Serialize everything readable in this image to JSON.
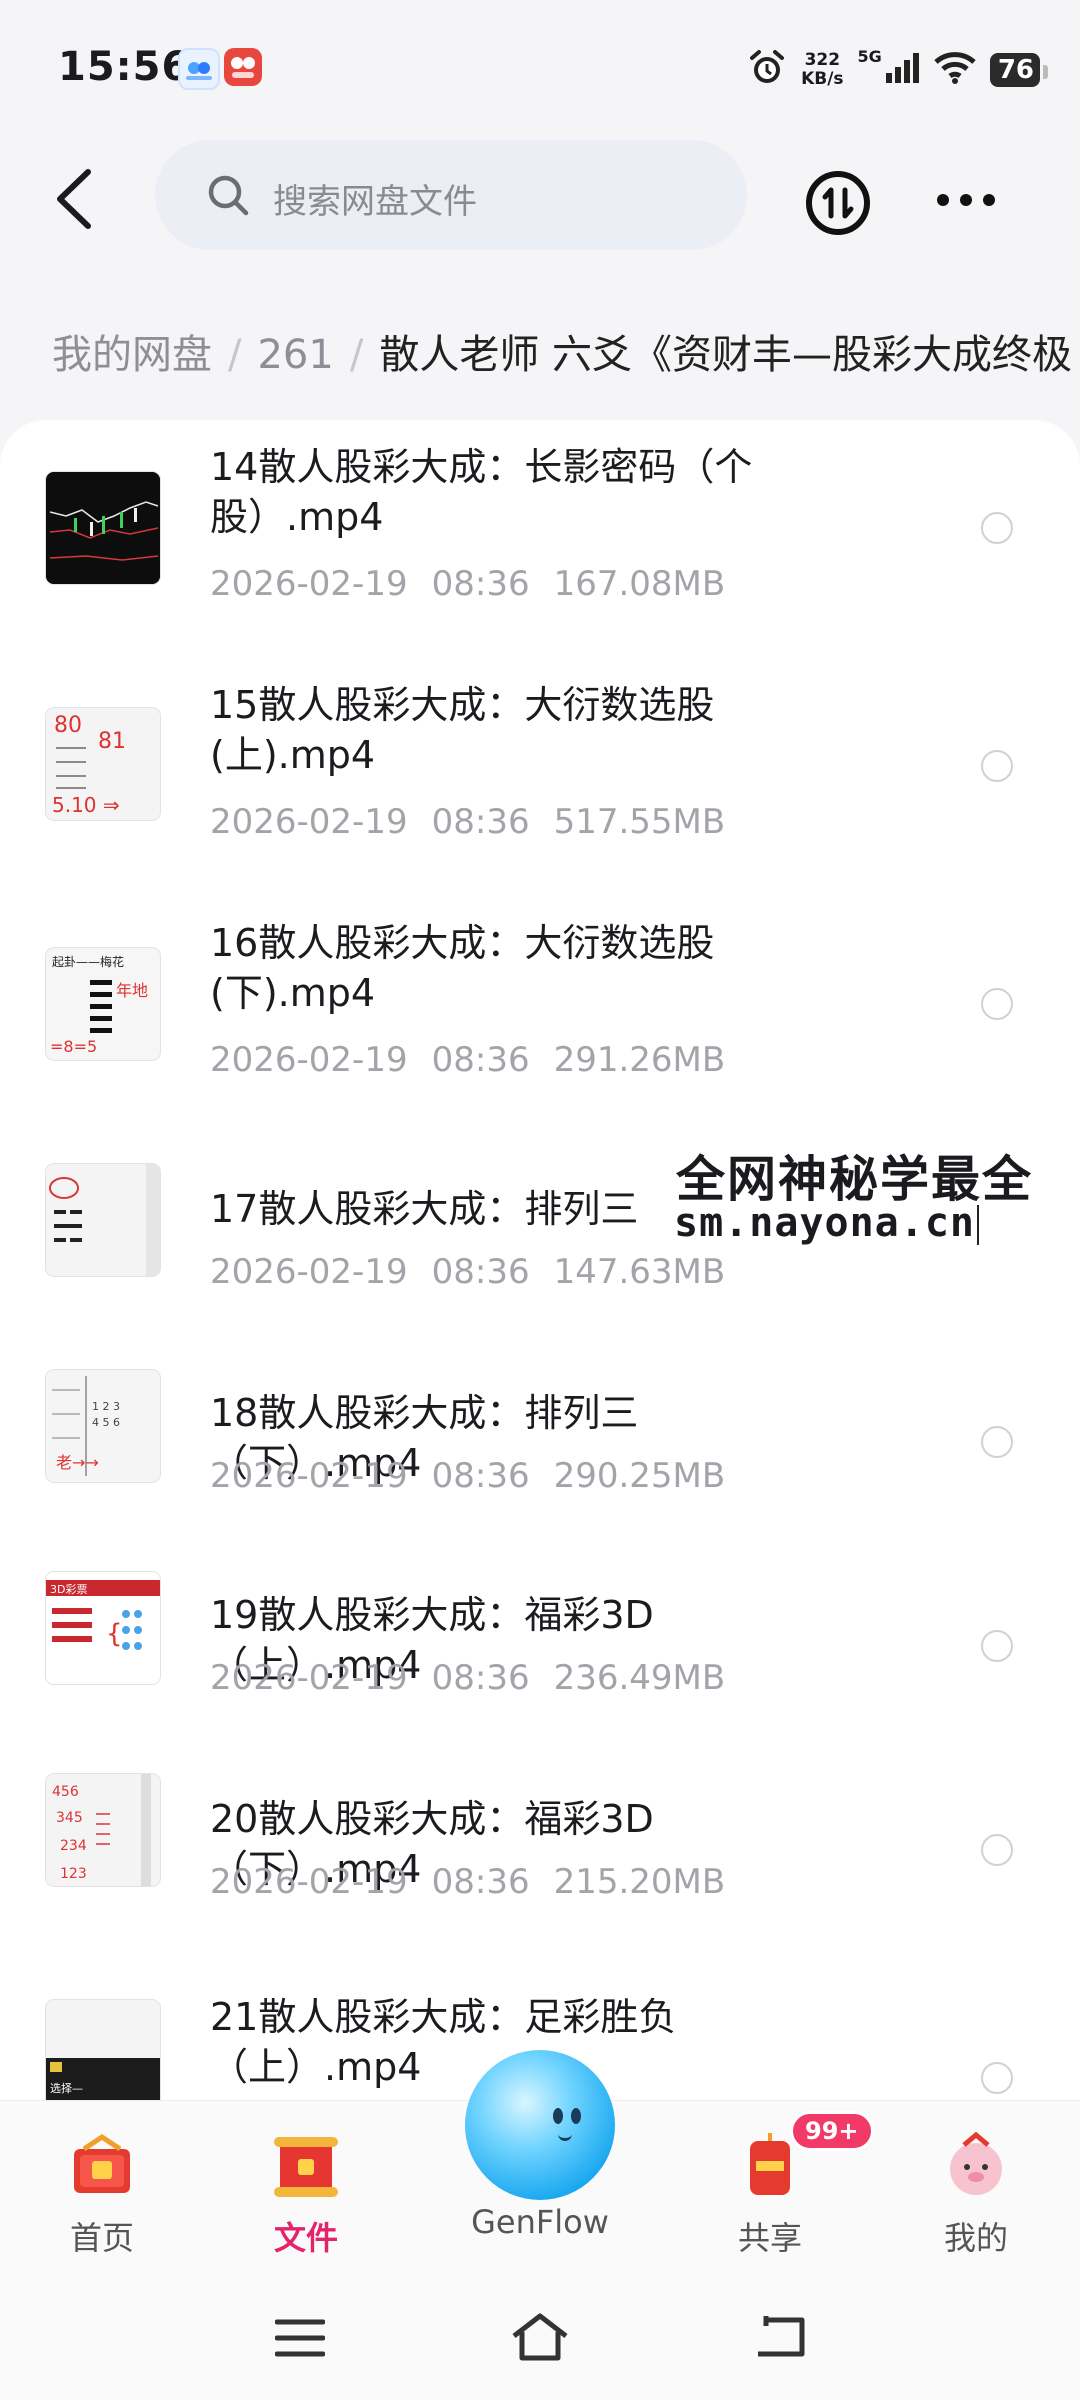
{
  "status_bar": {
    "time": "15:56",
    "net_speed_value": "322",
    "net_speed_unit": "KB/s",
    "network": "5G",
    "battery": "76"
  },
  "top_bar": {
    "search_placeholder": "搜索网盘文件"
  },
  "breadcrumb": {
    "items": [
      "我的网盘",
      "261",
      "散人老师 六爻《资财丰—股彩大成终极"
    ]
  },
  "files": [
    {
      "name": "14散人股彩大成：长影密码（个股）.mp4",
      "date": "2026-02-19",
      "time": "08:36",
      "size": "167.08MB"
    },
    {
      "name": "15散人股彩大成：大衍数选股(上).mp4",
      "date": "2026-02-19",
      "time": "08:36",
      "size": "517.55MB"
    },
    {
      "name": "16散人股彩大成：大衍数选股(下).mp4",
      "date": "2026-02-19",
      "time": "08:36",
      "size": "291.26MB"
    },
    {
      "name": "17散人股彩大成：排列三",
      "date": "2026-02-19",
      "time": "08:36",
      "size": "147.63MB"
    },
    {
      "name": "18散人股彩大成：排列三（下）.mp4",
      "date": "2026-02-19",
      "time": "08:36",
      "size": "290.25MB"
    },
    {
      "name": "19散人股彩大成：福彩3D（上）.mp4",
      "date": "2026-02-19",
      "time": "08:36",
      "size": "236.49MB"
    },
    {
      "name": "20散人股彩大成：福彩3D（下）.mp4",
      "date": "2026-02-19",
      "time": "08:36",
      "size": "215.20MB"
    },
    {
      "name": "21散人股彩大成：足彩胜负（上）.mp4",
      "date": "",
      "time": "",
      "size": ""
    }
  ],
  "watermark": {
    "line1": "全网神秘学最全",
    "line2": "sm.nayona.cn"
  },
  "tab_bar": {
    "home": "首页",
    "files": "文件",
    "genflow": "GenFlow",
    "share": "共享",
    "share_badge": "99+",
    "mine": "我的"
  },
  "colors": {
    "accent": "#e3246a",
    "badge": "#f23a69",
    "genflow": "#1aa8f0"
  }
}
